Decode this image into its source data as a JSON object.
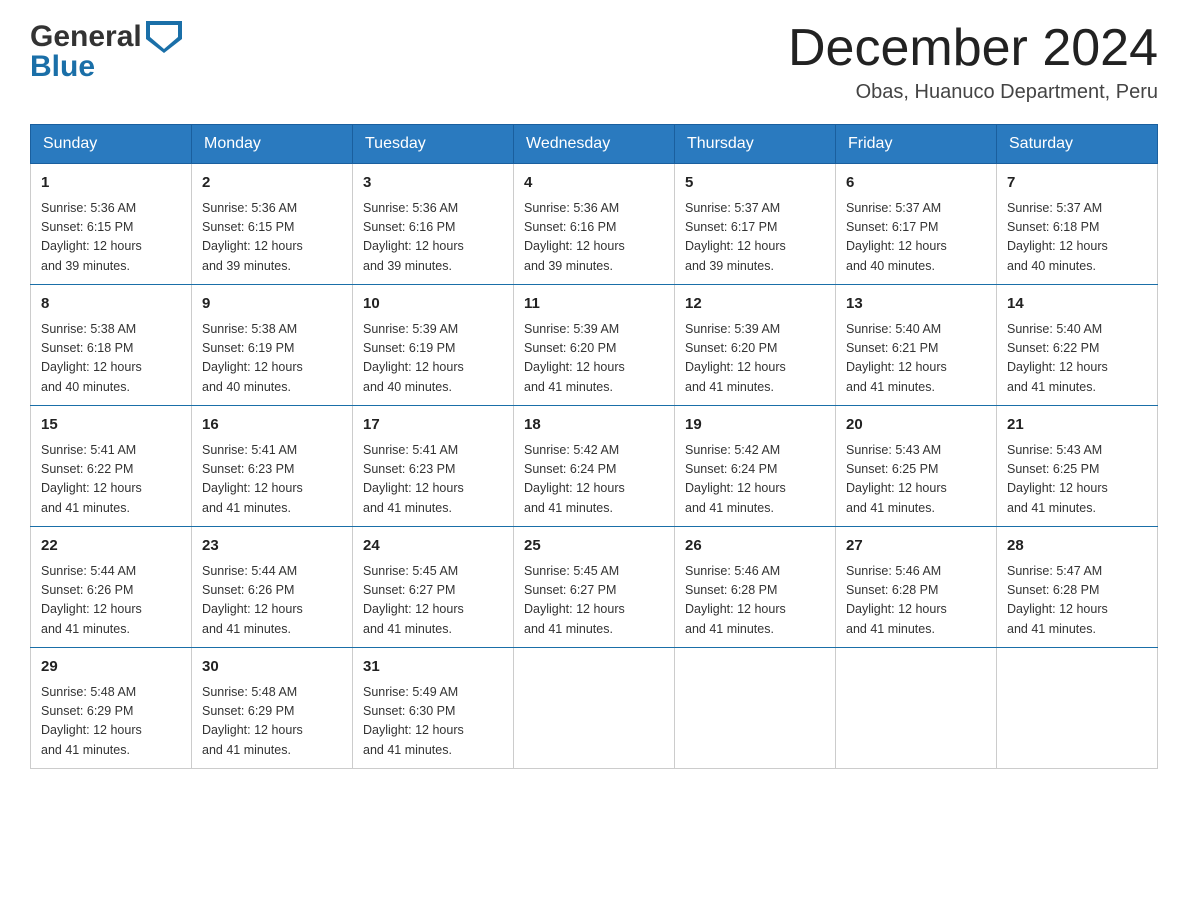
{
  "logo": {
    "part1": "General",
    "part2": "Blue"
  },
  "header": {
    "title": "December 2024",
    "location": "Obas, Huanuco Department, Peru"
  },
  "weekdays": [
    "Sunday",
    "Monday",
    "Tuesday",
    "Wednesday",
    "Thursday",
    "Friday",
    "Saturday"
  ],
  "weeks": [
    [
      {
        "day": "1",
        "sunrise": "5:36 AM",
        "sunset": "6:15 PM",
        "daylight": "12 hours and 39 minutes."
      },
      {
        "day": "2",
        "sunrise": "5:36 AM",
        "sunset": "6:15 PM",
        "daylight": "12 hours and 39 minutes."
      },
      {
        "day": "3",
        "sunrise": "5:36 AM",
        "sunset": "6:16 PM",
        "daylight": "12 hours and 39 minutes."
      },
      {
        "day": "4",
        "sunrise": "5:36 AM",
        "sunset": "6:16 PM",
        "daylight": "12 hours and 39 minutes."
      },
      {
        "day": "5",
        "sunrise": "5:37 AM",
        "sunset": "6:17 PM",
        "daylight": "12 hours and 39 minutes."
      },
      {
        "day": "6",
        "sunrise": "5:37 AM",
        "sunset": "6:17 PM",
        "daylight": "12 hours and 40 minutes."
      },
      {
        "day": "7",
        "sunrise": "5:37 AM",
        "sunset": "6:18 PM",
        "daylight": "12 hours and 40 minutes."
      }
    ],
    [
      {
        "day": "8",
        "sunrise": "5:38 AM",
        "sunset": "6:18 PM",
        "daylight": "12 hours and 40 minutes."
      },
      {
        "day": "9",
        "sunrise": "5:38 AM",
        "sunset": "6:19 PM",
        "daylight": "12 hours and 40 minutes."
      },
      {
        "day": "10",
        "sunrise": "5:39 AM",
        "sunset": "6:19 PM",
        "daylight": "12 hours and 40 minutes."
      },
      {
        "day": "11",
        "sunrise": "5:39 AM",
        "sunset": "6:20 PM",
        "daylight": "12 hours and 41 minutes."
      },
      {
        "day": "12",
        "sunrise": "5:39 AM",
        "sunset": "6:20 PM",
        "daylight": "12 hours and 41 minutes."
      },
      {
        "day": "13",
        "sunrise": "5:40 AM",
        "sunset": "6:21 PM",
        "daylight": "12 hours and 41 minutes."
      },
      {
        "day": "14",
        "sunrise": "5:40 AM",
        "sunset": "6:22 PM",
        "daylight": "12 hours and 41 minutes."
      }
    ],
    [
      {
        "day": "15",
        "sunrise": "5:41 AM",
        "sunset": "6:22 PM",
        "daylight": "12 hours and 41 minutes."
      },
      {
        "day": "16",
        "sunrise": "5:41 AM",
        "sunset": "6:23 PM",
        "daylight": "12 hours and 41 minutes."
      },
      {
        "day": "17",
        "sunrise": "5:41 AM",
        "sunset": "6:23 PM",
        "daylight": "12 hours and 41 minutes."
      },
      {
        "day": "18",
        "sunrise": "5:42 AM",
        "sunset": "6:24 PM",
        "daylight": "12 hours and 41 minutes."
      },
      {
        "day": "19",
        "sunrise": "5:42 AM",
        "sunset": "6:24 PM",
        "daylight": "12 hours and 41 minutes."
      },
      {
        "day": "20",
        "sunrise": "5:43 AM",
        "sunset": "6:25 PM",
        "daylight": "12 hours and 41 minutes."
      },
      {
        "day": "21",
        "sunrise": "5:43 AM",
        "sunset": "6:25 PM",
        "daylight": "12 hours and 41 minutes."
      }
    ],
    [
      {
        "day": "22",
        "sunrise": "5:44 AM",
        "sunset": "6:26 PM",
        "daylight": "12 hours and 41 minutes."
      },
      {
        "day": "23",
        "sunrise": "5:44 AM",
        "sunset": "6:26 PM",
        "daylight": "12 hours and 41 minutes."
      },
      {
        "day": "24",
        "sunrise": "5:45 AM",
        "sunset": "6:27 PM",
        "daylight": "12 hours and 41 minutes."
      },
      {
        "day": "25",
        "sunrise": "5:45 AM",
        "sunset": "6:27 PM",
        "daylight": "12 hours and 41 minutes."
      },
      {
        "day": "26",
        "sunrise": "5:46 AM",
        "sunset": "6:28 PM",
        "daylight": "12 hours and 41 minutes."
      },
      {
        "day": "27",
        "sunrise": "5:46 AM",
        "sunset": "6:28 PM",
        "daylight": "12 hours and 41 minutes."
      },
      {
        "day": "28",
        "sunrise": "5:47 AM",
        "sunset": "6:28 PM",
        "daylight": "12 hours and 41 minutes."
      }
    ],
    [
      {
        "day": "29",
        "sunrise": "5:48 AM",
        "sunset": "6:29 PM",
        "daylight": "12 hours and 41 minutes."
      },
      {
        "day": "30",
        "sunrise": "5:48 AM",
        "sunset": "6:29 PM",
        "daylight": "12 hours and 41 minutes."
      },
      {
        "day": "31",
        "sunrise": "5:49 AM",
        "sunset": "6:30 PM",
        "daylight": "12 hours and 41 minutes."
      },
      null,
      null,
      null,
      null
    ]
  ],
  "labels": {
    "sunrise": "Sunrise:",
    "sunset": "Sunset:",
    "daylight": "Daylight:"
  }
}
